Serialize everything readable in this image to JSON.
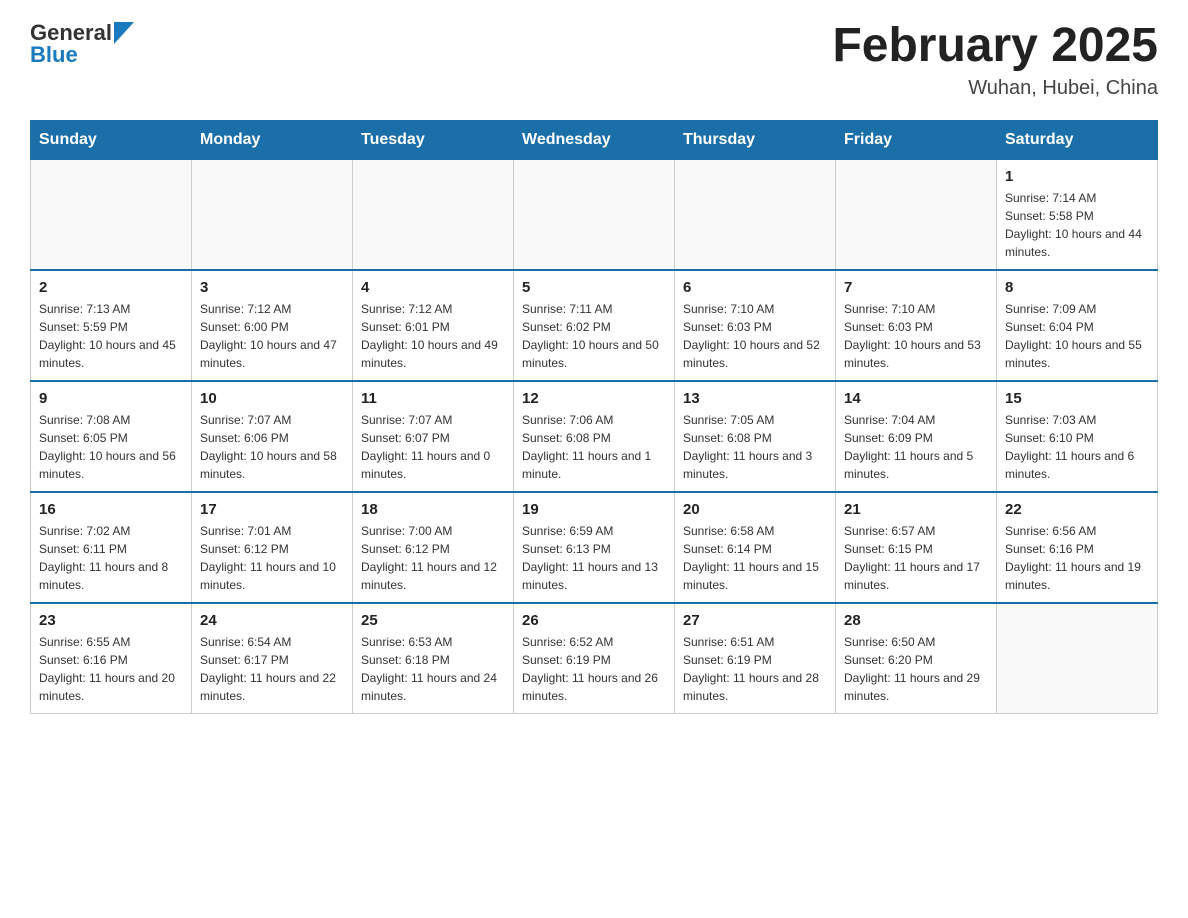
{
  "header": {
    "logo_text_general": "General",
    "logo_text_blue": "Blue",
    "month_title": "February 2025",
    "location": "Wuhan, Hubei, China"
  },
  "days_of_week": [
    "Sunday",
    "Monday",
    "Tuesday",
    "Wednesday",
    "Thursday",
    "Friday",
    "Saturday"
  ],
  "weeks": [
    [
      {
        "day": "",
        "sunrise": "",
        "sunset": "",
        "daylight": ""
      },
      {
        "day": "",
        "sunrise": "",
        "sunset": "",
        "daylight": ""
      },
      {
        "day": "",
        "sunrise": "",
        "sunset": "",
        "daylight": ""
      },
      {
        "day": "",
        "sunrise": "",
        "sunset": "",
        "daylight": ""
      },
      {
        "day": "",
        "sunrise": "",
        "sunset": "",
        "daylight": ""
      },
      {
        "day": "",
        "sunrise": "",
        "sunset": "",
        "daylight": ""
      },
      {
        "day": "1",
        "sunrise": "Sunrise: 7:14 AM",
        "sunset": "Sunset: 5:58 PM",
        "daylight": "Daylight: 10 hours and 44 minutes."
      }
    ],
    [
      {
        "day": "2",
        "sunrise": "Sunrise: 7:13 AM",
        "sunset": "Sunset: 5:59 PM",
        "daylight": "Daylight: 10 hours and 45 minutes."
      },
      {
        "day": "3",
        "sunrise": "Sunrise: 7:12 AM",
        "sunset": "Sunset: 6:00 PM",
        "daylight": "Daylight: 10 hours and 47 minutes."
      },
      {
        "day": "4",
        "sunrise": "Sunrise: 7:12 AM",
        "sunset": "Sunset: 6:01 PM",
        "daylight": "Daylight: 10 hours and 49 minutes."
      },
      {
        "day": "5",
        "sunrise": "Sunrise: 7:11 AM",
        "sunset": "Sunset: 6:02 PM",
        "daylight": "Daylight: 10 hours and 50 minutes."
      },
      {
        "day": "6",
        "sunrise": "Sunrise: 7:10 AM",
        "sunset": "Sunset: 6:03 PM",
        "daylight": "Daylight: 10 hours and 52 minutes."
      },
      {
        "day": "7",
        "sunrise": "Sunrise: 7:10 AM",
        "sunset": "Sunset: 6:03 PM",
        "daylight": "Daylight: 10 hours and 53 minutes."
      },
      {
        "day": "8",
        "sunrise": "Sunrise: 7:09 AM",
        "sunset": "Sunset: 6:04 PM",
        "daylight": "Daylight: 10 hours and 55 minutes."
      }
    ],
    [
      {
        "day": "9",
        "sunrise": "Sunrise: 7:08 AM",
        "sunset": "Sunset: 6:05 PM",
        "daylight": "Daylight: 10 hours and 56 minutes."
      },
      {
        "day": "10",
        "sunrise": "Sunrise: 7:07 AM",
        "sunset": "Sunset: 6:06 PM",
        "daylight": "Daylight: 10 hours and 58 minutes."
      },
      {
        "day": "11",
        "sunrise": "Sunrise: 7:07 AM",
        "sunset": "Sunset: 6:07 PM",
        "daylight": "Daylight: 11 hours and 0 minutes."
      },
      {
        "day": "12",
        "sunrise": "Sunrise: 7:06 AM",
        "sunset": "Sunset: 6:08 PM",
        "daylight": "Daylight: 11 hours and 1 minute."
      },
      {
        "day": "13",
        "sunrise": "Sunrise: 7:05 AM",
        "sunset": "Sunset: 6:08 PM",
        "daylight": "Daylight: 11 hours and 3 minutes."
      },
      {
        "day": "14",
        "sunrise": "Sunrise: 7:04 AM",
        "sunset": "Sunset: 6:09 PM",
        "daylight": "Daylight: 11 hours and 5 minutes."
      },
      {
        "day": "15",
        "sunrise": "Sunrise: 7:03 AM",
        "sunset": "Sunset: 6:10 PM",
        "daylight": "Daylight: 11 hours and 6 minutes."
      }
    ],
    [
      {
        "day": "16",
        "sunrise": "Sunrise: 7:02 AM",
        "sunset": "Sunset: 6:11 PM",
        "daylight": "Daylight: 11 hours and 8 minutes."
      },
      {
        "day": "17",
        "sunrise": "Sunrise: 7:01 AM",
        "sunset": "Sunset: 6:12 PM",
        "daylight": "Daylight: 11 hours and 10 minutes."
      },
      {
        "day": "18",
        "sunrise": "Sunrise: 7:00 AM",
        "sunset": "Sunset: 6:12 PM",
        "daylight": "Daylight: 11 hours and 12 minutes."
      },
      {
        "day": "19",
        "sunrise": "Sunrise: 6:59 AM",
        "sunset": "Sunset: 6:13 PM",
        "daylight": "Daylight: 11 hours and 13 minutes."
      },
      {
        "day": "20",
        "sunrise": "Sunrise: 6:58 AM",
        "sunset": "Sunset: 6:14 PM",
        "daylight": "Daylight: 11 hours and 15 minutes."
      },
      {
        "day": "21",
        "sunrise": "Sunrise: 6:57 AM",
        "sunset": "Sunset: 6:15 PM",
        "daylight": "Daylight: 11 hours and 17 minutes."
      },
      {
        "day": "22",
        "sunrise": "Sunrise: 6:56 AM",
        "sunset": "Sunset: 6:16 PM",
        "daylight": "Daylight: 11 hours and 19 minutes."
      }
    ],
    [
      {
        "day": "23",
        "sunrise": "Sunrise: 6:55 AM",
        "sunset": "Sunset: 6:16 PM",
        "daylight": "Daylight: 11 hours and 20 minutes."
      },
      {
        "day": "24",
        "sunrise": "Sunrise: 6:54 AM",
        "sunset": "Sunset: 6:17 PM",
        "daylight": "Daylight: 11 hours and 22 minutes."
      },
      {
        "day": "25",
        "sunrise": "Sunrise: 6:53 AM",
        "sunset": "Sunset: 6:18 PM",
        "daylight": "Daylight: 11 hours and 24 minutes."
      },
      {
        "day": "26",
        "sunrise": "Sunrise: 6:52 AM",
        "sunset": "Sunset: 6:19 PM",
        "daylight": "Daylight: 11 hours and 26 minutes."
      },
      {
        "day": "27",
        "sunrise": "Sunrise: 6:51 AM",
        "sunset": "Sunset: 6:19 PM",
        "daylight": "Daylight: 11 hours and 28 minutes."
      },
      {
        "day": "28",
        "sunrise": "Sunrise: 6:50 AM",
        "sunset": "Sunset: 6:20 PM",
        "daylight": "Daylight: 11 hours and 29 minutes."
      },
      {
        "day": "",
        "sunrise": "",
        "sunset": "",
        "daylight": ""
      }
    ]
  ]
}
